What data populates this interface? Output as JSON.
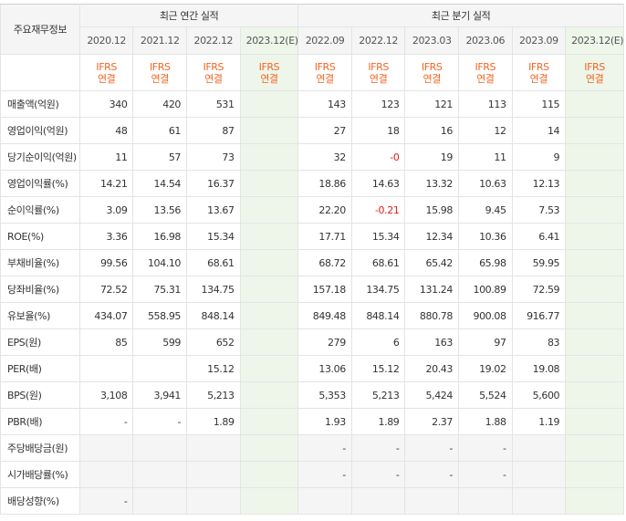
{
  "header": {
    "row_label": "주요재무정보",
    "annual_title": "최근 연간 실적",
    "quarter_title": "최근 분기 실적"
  },
  "periods": [
    "2020.12",
    "2021.12",
    "2022.12",
    "2023.12(E)",
    "2022.09",
    "2022.12",
    "2023.03",
    "2023.06",
    "2023.09",
    "2023.12(E)"
  ],
  "ifrs": {
    "line1": "IFRS",
    "line2": "연결"
  },
  "rows": [
    {
      "label": "매출액(억원)",
      "values": [
        "340",
        "420",
        "531",
        "",
        "143",
        "123",
        "121",
        "113",
        "115",
        ""
      ]
    },
    {
      "label": "영업이익(억원)",
      "values": [
        "48",
        "61",
        "87",
        "",
        "27",
        "18",
        "16",
        "12",
        "14",
        ""
      ]
    },
    {
      "label": "당기순이익(억원)",
      "values": [
        "11",
        "57",
        "73",
        "",
        "32",
        "-0",
        "19",
        "11",
        "9",
        ""
      ]
    },
    {
      "label": "영업이익률(%)",
      "values": [
        "14.21",
        "14.54",
        "16.37",
        "",
        "18.86",
        "14.63",
        "13.32",
        "10.63",
        "12.13",
        ""
      ]
    },
    {
      "label": "순이익률(%)",
      "values": [
        "3.09",
        "13.56",
        "13.67",
        "",
        "22.20",
        "-0.21",
        "15.98",
        "9.45",
        "7.53",
        ""
      ]
    },
    {
      "label": "ROE(%)",
      "values": [
        "3.36",
        "16.98",
        "15.34",
        "",
        "17.71",
        "15.34",
        "12.34",
        "10.36",
        "6.41",
        ""
      ]
    },
    {
      "label": "부채비율(%)",
      "values": [
        "99.56",
        "104.10",
        "68.61",
        "",
        "68.72",
        "68.61",
        "65.42",
        "65.98",
        "59.95",
        ""
      ]
    },
    {
      "label": "당좌비율(%)",
      "values": [
        "72.52",
        "75.31",
        "134.75",
        "",
        "157.18",
        "134.75",
        "131.24",
        "100.89",
        "72.59",
        ""
      ]
    },
    {
      "label": "유보율(%)",
      "values": [
        "434.07",
        "558.95",
        "848.14",
        "",
        "849.48",
        "848.14",
        "880.78",
        "900.08",
        "916.77",
        ""
      ]
    },
    {
      "label": "EPS(원)",
      "values": [
        "85",
        "599",
        "652",
        "",
        "279",
        "6",
        "163",
        "97",
        "83",
        ""
      ]
    },
    {
      "label": "PER(배)",
      "values": [
        "",
        "",
        "15.12",
        "",
        "13.06",
        "15.12",
        "20.43",
        "19.02",
        "19.08",
        ""
      ]
    },
    {
      "label": "BPS(원)",
      "values": [
        "3,108",
        "3,941",
        "5,213",
        "",
        "5,353",
        "5,213",
        "5,424",
        "5,524",
        "5,600",
        ""
      ]
    },
    {
      "label": "PBR(배)",
      "values": [
        "-",
        "-",
        "1.89",
        "",
        "1.93",
        "1.89",
        "2.37",
        "1.88",
        "1.19",
        ""
      ]
    },
    {
      "label": "주당배당금(원)",
      "values": [
        "",
        "",
        "",
        "",
        "-",
        "-",
        "-",
        "-",
        "",
        ""
      ]
    },
    {
      "label": "시가배당률(%)",
      "values": [
        "",
        "",
        "",
        "",
        "-",
        "-",
        "-",
        "-",
        "",
        ""
      ]
    },
    {
      "label": "배당성향(%)",
      "values": [
        "-",
        "",
        "",
        "",
        "",
        "",
        "",
        "",
        "",
        ""
      ]
    }
  ],
  "colors": {
    "ifrs": "#f26522",
    "negative": "#e02020",
    "estimate_bg": "#eef6ea"
  }
}
